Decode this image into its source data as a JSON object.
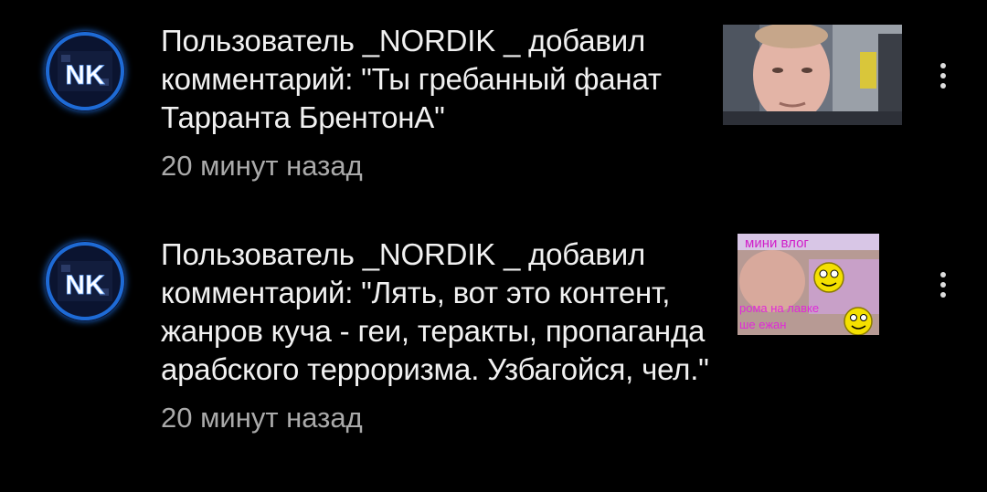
{
  "notifications": [
    {
      "avatar_icon": "nk-avatar-icon",
      "avatar_initials": "NK",
      "message": "Пользователь _NORDIK _ добавил комментарий: \"Ты гребанный фанат Тарранта БрентонА\"",
      "timestamp": "20 минут назад",
      "thumbnail_icon": "video-thumbnail-man-in-airport",
      "menu_icon": "more-vert-icon"
    },
    {
      "avatar_icon": "nk-avatar-icon",
      "avatar_initials": "NK",
      "message": "Пользователь _NORDIK _ добавил комментарий: \"Лять, вот это контент, жанров куча - геи, теракты, пропаганда арабского терроризма. Узбагойся, чел.\"",
      "timestamp": "20 минут назад",
      "thumbnail_icon": "video-thumbnail-mini-vlog",
      "thumbnail_text_top": "мини влог",
      "thumbnail_text_bottom_1": "рома на лавке",
      "thumbnail_text_bottom_2": "ше ежан",
      "menu_icon": "more-vert-icon"
    }
  ],
  "colors": {
    "background": "#000000",
    "message_text": "#f1f1f1",
    "timestamp_text": "#aaaaaa",
    "avatar_ring": "#1e6bd6",
    "menu_dots": "#dddddd"
  }
}
